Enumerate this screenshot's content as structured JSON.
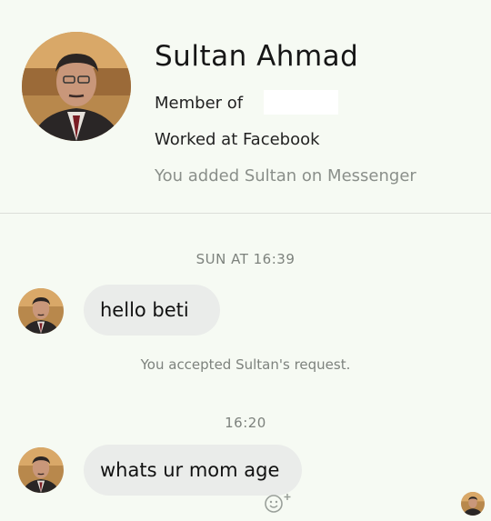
{
  "profile": {
    "name": "Sultan Ahmad",
    "member_of_label": "Member of",
    "work_label": "Worked at Facebook",
    "added_label": "You added Sultan on Messenger"
  },
  "conversation": {
    "timestamp_1": "SUN AT 16:39",
    "message_1": "hello beti",
    "system_message": "You accepted Sultan's request.",
    "timestamp_2": "16:20",
    "message_2": "whats ur mom age"
  },
  "icons": {
    "react": "smiley-add-icon",
    "seen": "read-receipt-avatar"
  },
  "colors": {
    "background": "#f6faf3",
    "bubble": "#eaecea",
    "muted_text": "#7d827d"
  }
}
